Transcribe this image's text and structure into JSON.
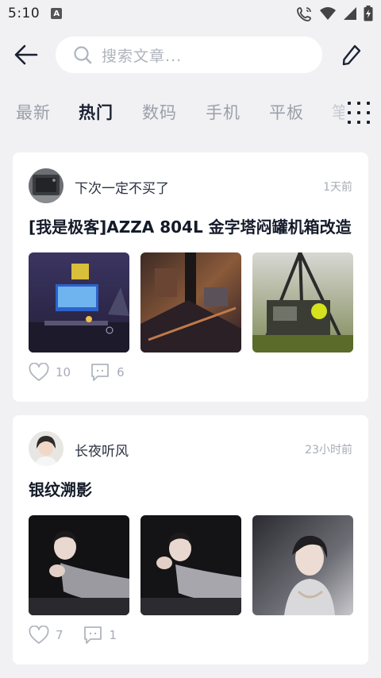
{
  "status": {
    "time": "5:10",
    "indicator": "A"
  },
  "header": {
    "search_placeholder": "搜索文章...",
    "icons": {
      "back": "back-arrow-icon",
      "search": "search-icon",
      "edit": "pencil-icon"
    }
  },
  "tabs": [
    "最新",
    "热门",
    "数码",
    "手机",
    "平板"
  ],
  "active_tab": "热门",
  "colors": {
    "background": "#f1f1f3",
    "card": "#ffffff",
    "muted": "#a7acb5",
    "title": "#141a29"
  },
  "posts": [
    {
      "author": "下次一定不买了",
      "time": "1天前",
      "title": "[我是极客]AZZA 804L 金字塔闷罐机箱改造",
      "likes": "10",
      "comments": "6"
    },
    {
      "author": "长夜听风",
      "time": "23小时前",
      "title": "银纹溯影",
      "likes": "7",
      "comments": "1"
    }
  ]
}
